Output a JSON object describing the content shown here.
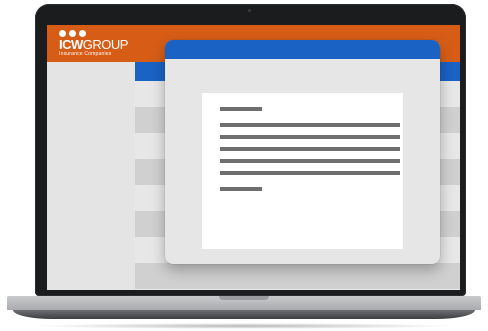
{
  "brand": {
    "logo_main": "ICW",
    "logo_rest": "GROUP",
    "logo_sub": "Insurance Companies"
  },
  "colors": {
    "header": "#d75d17",
    "accent_blue": "#1a62c4",
    "screen_bg": "#e9e9e9",
    "text_placeholder": "#6f6f6f"
  },
  "icons": [
    "logo-dot-icon"
  ]
}
